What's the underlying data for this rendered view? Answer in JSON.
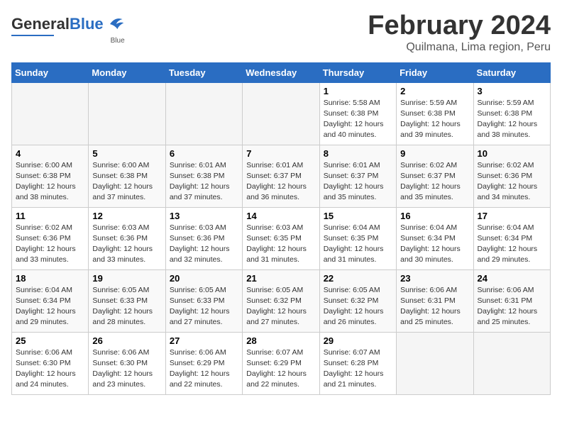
{
  "header": {
    "logo_general": "General",
    "logo_blue": "Blue",
    "title": "February 2024",
    "subtitle": "Quilmana, Lima region, Peru"
  },
  "weekdays": [
    "Sunday",
    "Monday",
    "Tuesday",
    "Wednesday",
    "Thursday",
    "Friday",
    "Saturday"
  ],
  "weeks": [
    [
      {
        "day": "",
        "info": ""
      },
      {
        "day": "",
        "info": ""
      },
      {
        "day": "",
        "info": ""
      },
      {
        "day": "",
        "info": ""
      },
      {
        "day": "1",
        "info": "Sunrise: 5:58 AM\nSunset: 6:38 PM\nDaylight: 12 hours\nand 40 minutes."
      },
      {
        "day": "2",
        "info": "Sunrise: 5:59 AM\nSunset: 6:38 PM\nDaylight: 12 hours\nand 39 minutes."
      },
      {
        "day": "3",
        "info": "Sunrise: 5:59 AM\nSunset: 6:38 PM\nDaylight: 12 hours\nand 38 minutes."
      }
    ],
    [
      {
        "day": "4",
        "info": "Sunrise: 6:00 AM\nSunset: 6:38 PM\nDaylight: 12 hours\nand 38 minutes."
      },
      {
        "day": "5",
        "info": "Sunrise: 6:00 AM\nSunset: 6:38 PM\nDaylight: 12 hours\nand 37 minutes."
      },
      {
        "day": "6",
        "info": "Sunrise: 6:01 AM\nSunset: 6:38 PM\nDaylight: 12 hours\nand 37 minutes."
      },
      {
        "day": "7",
        "info": "Sunrise: 6:01 AM\nSunset: 6:37 PM\nDaylight: 12 hours\nand 36 minutes."
      },
      {
        "day": "8",
        "info": "Sunrise: 6:01 AM\nSunset: 6:37 PM\nDaylight: 12 hours\nand 35 minutes."
      },
      {
        "day": "9",
        "info": "Sunrise: 6:02 AM\nSunset: 6:37 PM\nDaylight: 12 hours\nand 35 minutes."
      },
      {
        "day": "10",
        "info": "Sunrise: 6:02 AM\nSunset: 6:36 PM\nDaylight: 12 hours\nand 34 minutes."
      }
    ],
    [
      {
        "day": "11",
        "info": "Sunrise: 6:02 AM\nSunset: 6:36 PM\nDaylight: 12 hours\nand 33 minutes."
      },
      {
        "day": "12",
        "info": "Sunrise: 6:03 AM\nSunset: 6:36 PM\nDaylight: 12 hours\nand 33 minutes."
      },
      {
        "day": "13",
        "info": "Sunrise: 6:03 AM\nSunset: 6:36 PM\nDaylight: 12 hours\nand 32 minutes."
      },
      {
        "day": "14",
        "info": "Sunrise: 6:03 AM\nSunset: 6:35 PM\nDaylight: 12 hours\nand 31 minutes."
      },
      {
        "day": "15",
        "info": "Sunrise: 6:04 AM\nSunset: 6:35 PM\nDaylight: 12 hours\nand 31 minutes."
      },
      {
        "day": "16",
        "info": "Sunrise: 6:04 AM\nSunset: 6:34 PM\nDaylight: 12 hours\nand 30 minutes."
      },
      {
        "day": "17",
        "info": "Sunrise: 6:04 AM\nSunset: 6:34 PM\nDaylight: 12 hours\nand 29 minutes."
      }
    ],
    [
      {
        "day": "18",
        "info": "Sunrise: 6:04 AM\nSunset: 6:34 PM\nDaylight: 12 hours\nand 29 minutes."
      },
      {
        "day": "19",
        "info": "Sunrise: 6:05 AM\nSunset: 6:33 PM\nDaylight: 12 hours\nand 28 minutes."
      },
      {
        "day": "20",
        "info": "Sunrise: 6:05 AM\nSunset: 6:33 PM\nDaylight: 12 hours\nand 27 minutes."
      },
      {
        "day": "21",
        "info": "Sunrise: 6:05 AM\nSunset: 6:32 PM\nDaylight: 12 hours\nand 27 minutes."
      },
      {
        "day": "22",
        "info": "Sunrise: 6:05 AM\nSunset: 6:32 PM\nDaylight: 12 hours\nand 26 minutes."
      },
      {
        "day": "23",
        "info": "Sunrise: 6:06 AM\nSunset: 6:31 PM\nDaylight: 12 hours\nand 25 minutes."
      },
      {
        "day": "24",
        "info": "Sunrise: 6:06 AM\nSunset: 6:31 PM\nDaylight: 12 hours\nand 25 minutes."
      }
    ],
    [
      {
        "day": "25",
        "info": "Sunrise: 6:06 AM\nSunset: 6:30 PM\nDaylight: 12 hours\nand 24 minutes."
      },
      {
        "day": "26",
        "info": "Sunrise: 6:06 AM\nSunset: 6:30 PM\nDaylight: 12 hours\nand 23 minutes."
      },
      {
        "day": "27",
        "info": "Sunrise: 6:06 AM\nSunset: 6:29 PM\nDaylight: 12 hours\nand 22 minutes."
      },
      {
        "day": "28",
        "info": "Sunrise: 6:07 AM\nSunset: 6:29 PM\nDaylight: 12 hours\nand 22 minutes."
      },
      {
        "day": "29",
        "info": "Sunrise: 6:07 AM\nSunset: 6:28 PM\nDaylight: 12 hours\nand 21 minutes."
      },
      {
        "day": "",
        "info": ""
      },
      {
        "day": "",
        "info": ""
      }
    ]
  ]
}
